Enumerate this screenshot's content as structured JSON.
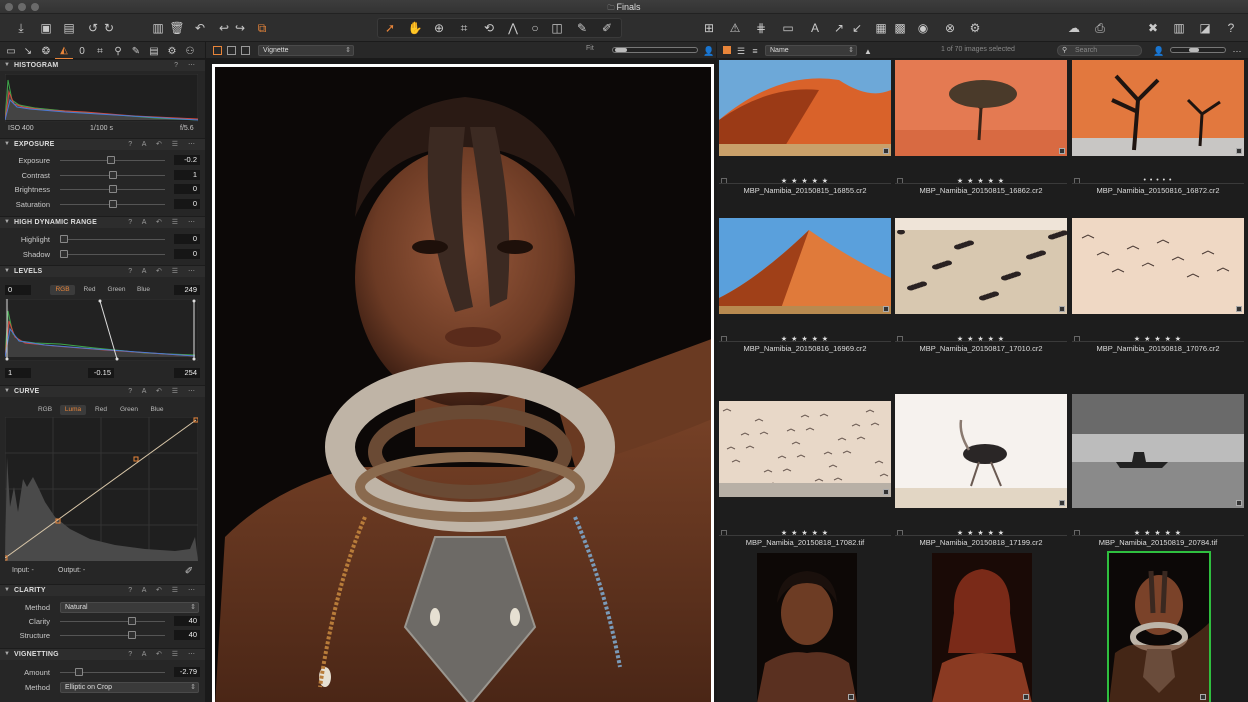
{
  "window": {
    "title": "Finals",
    "folder_icon": "folder-icon"
  },
  "viewer_bar": {
    "style_preset": "Vignette",
    "fit_label": "Fit"
  },
  "browser_bar": {
    "sort_by": "Name",
    "selection_count": "1 of 70 images selected",
    "search_placeholder": "Search"
  },
  "histogram": {
    "title": "HISTOGRAM",
    "iso": "ISO 400",
    "shutter": "1/100 s",
    "aperture": "f/5.6"
  },
  "exposure": {
    "title": "EXPOSURE",
    "rows": [
      {
        "label": "Exposure",
        "value": "-0.2",
        "level": 0.48
      },
      {
        "label": "Contrast",
        "value": "1",
        "level": 0.51
      },
      {
        "label": "Brightness",
        "value": "0",
        "level": 0.5
      },
      {
        "label": "Saturation",
        "value": "0",
        "level": 0.5
      }
    ]
  },
  "hdr": {
    "title": "HIGH DYNAMIC RANGE",
    "rows": [
      {
        "label": "Highlight",
        "value": "0",
        "level": 0.0
      },
      {
        "label": "Shadow",
        "value": "0",
        "level": 0.0
      }
    ]
  },
  "levels": {
    "title": "LEVELS",
    "low": "0",
    "high": "249",
    "channels": [
      "RGB",
      "Red",
      "Green",
      "Blue"
    ],
    "active": "RGB",
    "out_low": "1",
    "mid": "-0.15",
    "out_high": "254"
  },
  "curve": {
    "title": "CURVE",
    "channels": [
      "RGB",
      "Luma",
      "Red",
      "Green",
      "Blue"
    ],
    "active": "Luma",
    "input_label": "Input:",
    "output_label": "Output:",
    "input_value": "-",
    "output_value": "-"
  },
  "clarity": {
    "title": "CLARITY",
    "method_label": "Method",
    "method": "Natural",
    "rows": [
      {
        "label": "Clarity",
        "value": "40",
        "level": 0.7
      },
      {
        "label": "Structure",
        "value": "40",
        "level": 0.7
      }
    ]
  },
  "vignetting": {
    "title": "VIGNETTING",
    "amount_label": "Amount",
    "amount": "-2.79",
    "amount_level": 0.15,
    "method_label": "Method",
    "method": "Elliptic on Crop"
  },
  "browser": {
    "thumbs": [
      {
        "name": "MBP_Namibia_20150815_16855.cr2",
        "stars": "★ ★ ★ ★ ★",
        "kind": "dune"
      },
      {
        "name": "MBP_Namibia_20150815_16862.cr2",
        "stars": "★ ★ ★ ★ ★",
        "kind": "tree"
      },
      {
        "name": "MBP_Namibia_20150816_16872.cr2",
        "stars": "• • • • •",
        "kind": "deadtrees"
      },
      {
        "name": "MBP_Namibia_20150816_16969.cr2",
        "stars": "★ ★ ★ ★ ★",
        "kind": "dune2"
      },
      {
        "name": "MBP_Namibia_20150817_17010.cr2",
        "stars": "★ ★ ★ ★ ★",
        "kind": "flamingos"
      },
      {
        "name": "MBP_Namibia_20150818_17076.cr2",
        "stars": "★ ★ ★ ★ ★",
        "kind": "birds"
      },
      {
        "name": "MBP_Namibia_20150818_17082.tif",
        "stars": "★ ★ ★ ★ ★",
        "kind": "flock"
      },
      {
        "name": "MBP_Namibia_20150818_17199.cr2",
        "stars": "★ ★ ★ ★ ★",
        "kind": "ostrich"
      },
      {
        "name": "MBP_Namibia_20150819_20784.tif",
        "stars": "★ ★ ★ ★ ★",
        "kind": "ship"
      }
    ],
    "portraits": [
      {
        "kind": "girl"
      },
      {
        "kind": "woman"
      },
      {
        "kind": "boy",
        "selected": true
      }
    ]
  },
  "colors": {
    "accent": "#e8853a",
    "selection": "#2fbf3f"
  }
}
